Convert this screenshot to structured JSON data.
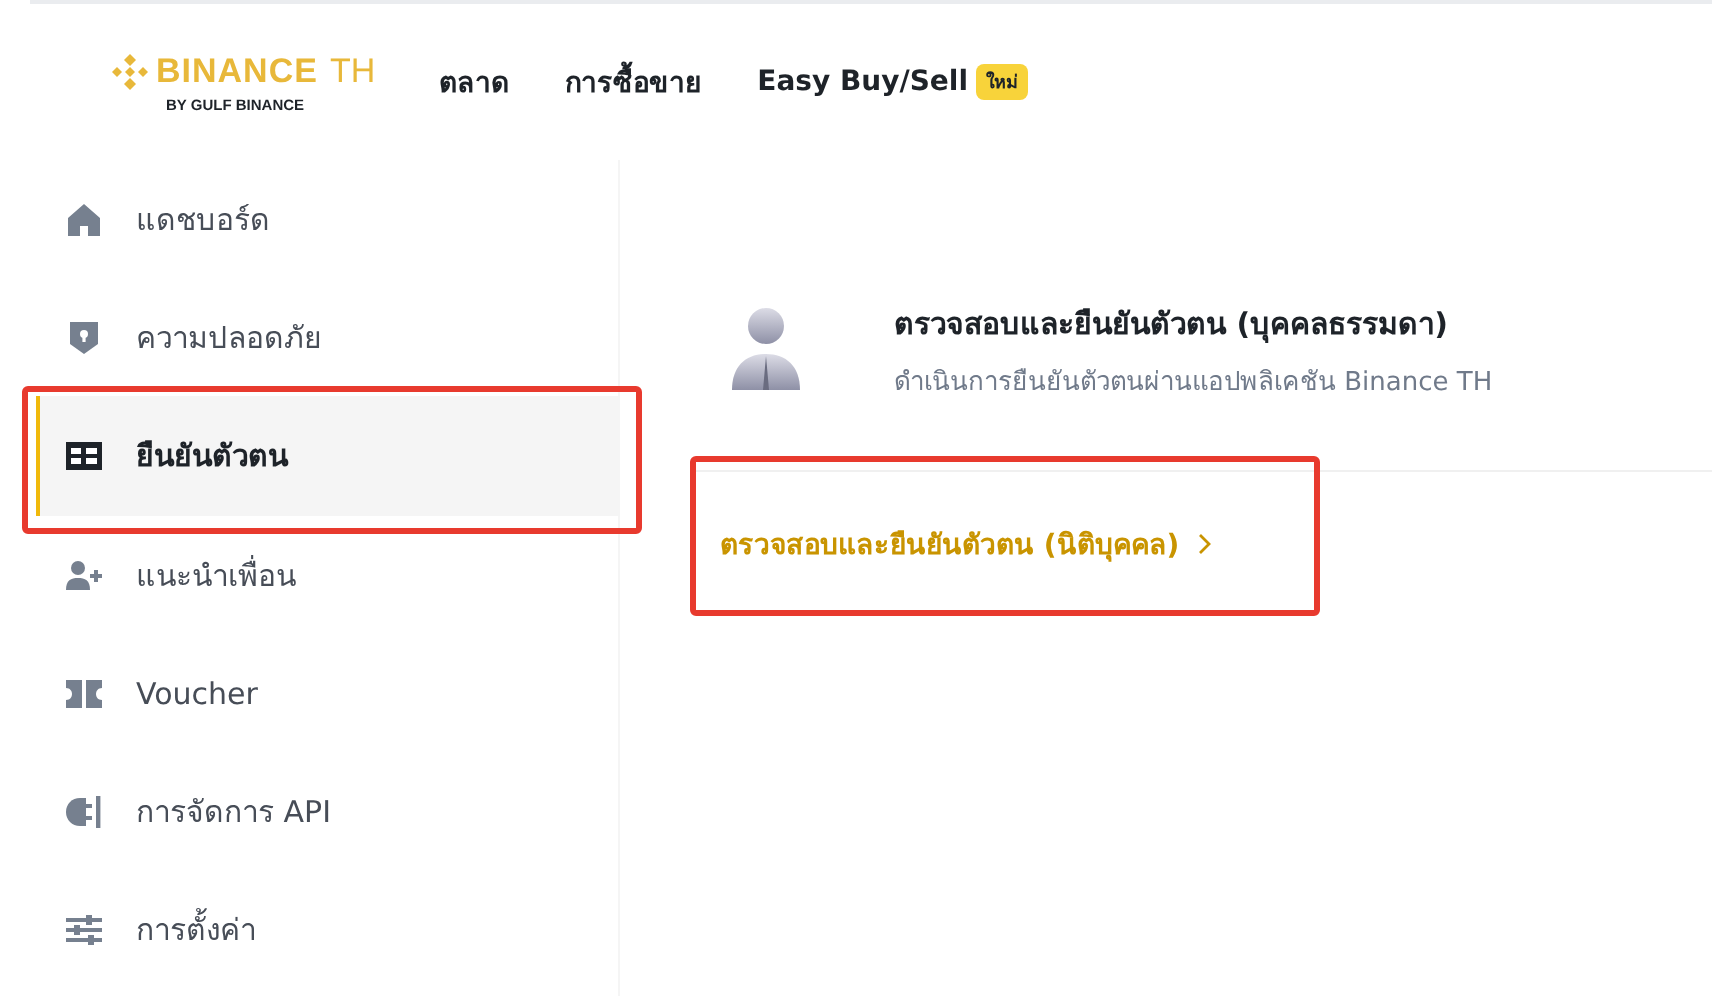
{
  "header": {
    "logo": {
      "name": "BINANCE",
      "suffix": "TH",
      "tagline": "BY GULF BINANCE"
    },
    "nav": [
      {
        "label": "ตลาด"
      },
      {
        "label": "การซื้อขาย"
      },
      {
        "label": "Easy Buy/Sell",
        "badge": "ใหม่"
      }
    ]
  },
  "sidebar": {
    "items": [
      {
        "label": "แดชบอร์ด",
        "selected": false,
        "highlighted": false
      },
      {
        "label": "ความปลอดภัย",
        "selected": false,
        "highlighted": false
      },
      {
        "label": "ยืนยันตัวตน",
        "selected": true,
        "highlighted": true
      },
      {
        "label": "แนะนำเพื่อน",
        "selected": false,
        "highlighted": false
      },
      {
        "label": "Voucher",
        "selected": false,
        "highlighted": false
      },
      {
        "label": "การจัดการ API",
        "selected": false,
        "highlighted": false
      },
      {
        "label": "การตั้งค่า",
        "selected": false,
        "highlighted": false
      }
    ]
  },
  "verification": {
    "title": "ตรวจสอบและยืนยันตัวตน (บุคคลธรรมดา)",
    "subtitle": "ดำเนินการยืนยันตัวตนผ่านแอปพลิเคชัน Binance TH"
  },
  "corporate_link": {
    "label": "ตรวจสอบและยืนยันตัวตน (นิติบุคคล)",
    "highlighted": true
  }
}
